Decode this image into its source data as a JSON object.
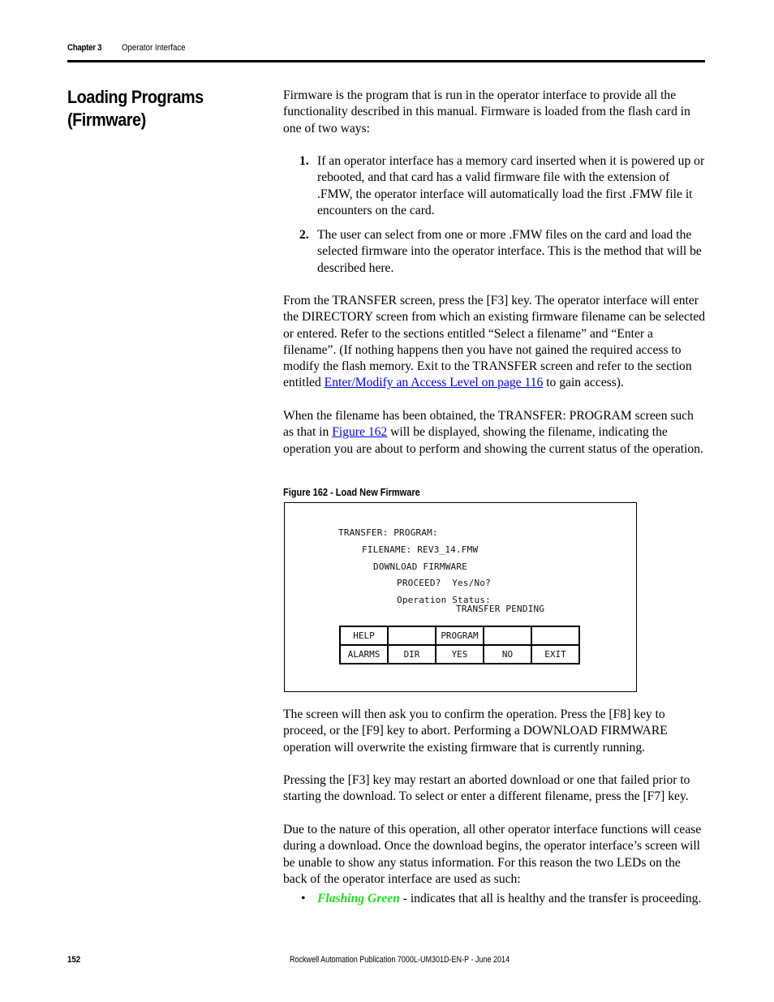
{
  "header": {
    "chapter": "Chapter 3",
    "section": "Operator Interface"
  },
  "section_title": "Loading Programs (Firmware)",
  "intro": "Firmware is the program that is run in the operator interface to provide all the functionality described in this manual. Firmware is loaded from the flash card in one of two ways:",
  "list": [
    {
      "num": "1.",
      "text": "If an operator interface has a memory card inserted when it is powered up or rebooted, and that card has a valid firmware file with the extension of .FMW, the operator interface will automatically load the first .FMW file it encounters on the card."
    },
    {
      "num": "2.",
      "text": "The user can select from one or more .FMW files on the card and load the selected firmware into the operator interface. This is the method that will be described here."
    }
  ],
  "para_transfer": {
    "before": "From the TRANSFER screen, press the [F3] key. The operator interface will enter the DIRECTORY screen from which an existing firmware filename can be selected or entered. Refer to the sections entitled “Select a filename” and “Enter a filename”. (If nothing happens then you have not gained the required access to modify the flash memory. Exit to the TRANSFER screen and refer to the section entitled ",
    "link": "Enter/Modify an Access Level  on page 116",
    "after": " to gain access)."
  },
  "para_filename": {
    "before": "When the filename has been obtained, the TRANSFER: PROGRAM screen such as that in ",
    "link": "Figure 162",
    "after": " will be displayed, showing the filename, indicating the operation you are about to perform and showing the current status of the operation."
  },
  "figure": {
    "caption": "Figure 162 - Load New Firmware",
    "lines": {
      "title": "TRANSFER: PROGRAM:",
      "filename": "FILENAME: REV3_14.FMW",
      "operation": "DOWNLOAD FIRMWARE",
      "proceed": "PROCEED?  Yes/No?",
      "status_label": "Operation Status:",
      "status_value": "TRANSFER PENDING"
    },
    "fkeys_top": [
      "HELP",
      "",
      "PROGRAM",
      "",
      ""
    ],
    "fkeys_bottom": [
      "ALARMS",
      "DIR",
      "YES",
      "NO",
      "EXIT"
    ]
  },
  "para_confirm": "The screen will then ask you to confirm the operation. Press the [F8] key to proceed, or the [F9] key to abort. Performing a DOWNLOAD FIRMWARE operation will overwrite the existing firmware that is currently running.",
  "para_restart": "Pressing the [F3] key may restart an aborted download or one that failed prior to starting the download. To select or enter a different filename, press the [F7] key.",
  "para_nature": "Due to the nature of this operation, all other operator interface functions will cease during a download. Once the download begins, the operator interface’s screen will be unable to show any status information. For this reason the two LEDs on the back of the operator interface are used as such:",
  "bullets": [
    {
      "term": "Flashing Green",
      "text": " - indicates that all is healthy and the transfer is proceeding.",
      "color": "#22dd22"
    }
  ],
  "footer": {
    "page": "152",
    "publication": "Rockwell Automation Publication 7000L-UM301D-EN-P - June 2014"
  }
}
